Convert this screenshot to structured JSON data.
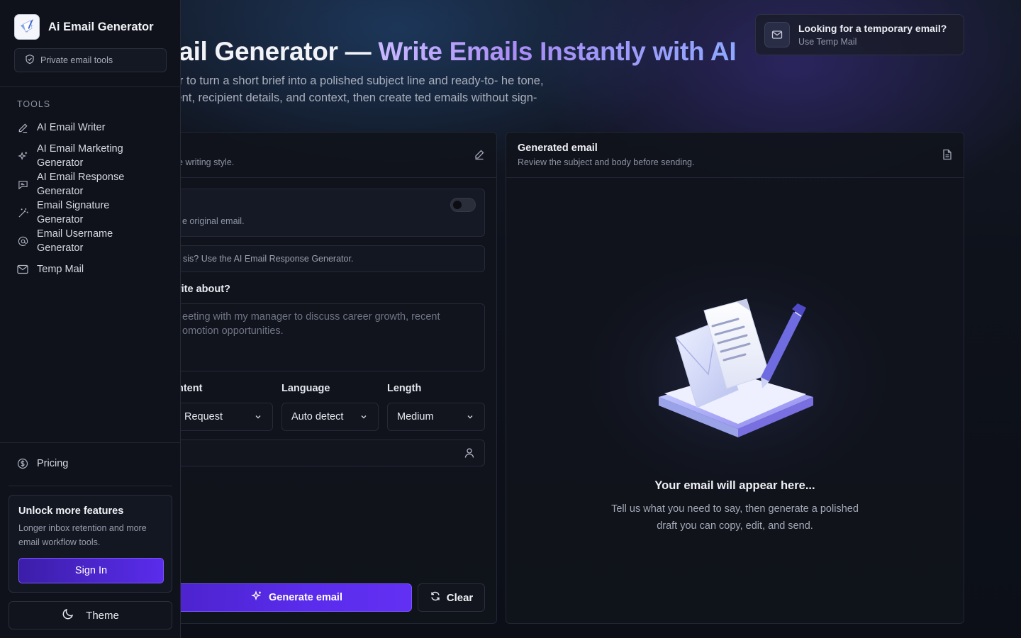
{
  "banner": {
    "title": "Looking for a temporary email?",
    "subtitle": "Use Temp Mail"
  },
  "hero": {
    "title_plain": "nail Generator — ",
    "title_highlight": "Write Emails Instantly with AI",
    "description": "ator to turn a short brief into a polished subject line and ready-to- he tone, intent, recipient details, and context, then create ted emails without sign-up."
  },
  "compose": {
    "subtitle": "ose the writing style.",
    "reply_sub": "e original email.",
    "hint": "sis? Use the AI Email Response Generator.",
    "question": "rite about?",
    "placeholder": "eeting with my manager to discuss career growth, recent omotion opportunities.",
    "intent_label": "ntent",
    "intent_value": "Request",
    "language_label": "Language",
    "language_value": "Auto detect",
    "length_label": "Length",
    "length_value": "Medium",
    "generate_label": "Generate email",
    "clear_label": "Clear"
  },
  "output": {
    "title": "Generated email",
    "subtitle": "Review the subject and body before sending.",
    "empty_title": "Your email will appear here...",
    "empty_desc": "Tell us what you need to say, then generate a polished draft you can copy, edit, and send."
  },
  "sidebar": {
    "brand": "Ai Email Generator",
    "private_label": "Private email tools",
    "tools_heading": "TOOLS",
    "items": [
      {
        "label": "AI Email Writer",
        "icon": "pencil-icon"
      },
      {
        "label": "AI Email Marketing Generator",
        "icon": "sparkles-icon"
      },
      {
        "label": "AI Email Response Generator",
        "icon": "message-reply-icon"
      },
      {
        "label": "Email Signature Generator",
        "icon": "magic-wand-icon"
      },
      {
        "label": "Email Username Generator",
        "icon": "at-sign-icon"
      },
      {
        "label": "Temp Mail",
        "icon": "mail-icon"
      }
    ],
    "pricing_label": "Pricing",
    "unlock_title": "Unlock more features",
    "unlock_desc": "Longer inbox retention and more email workflow tools.",
    "signin_label": "Sign In",
    "theme_label": "Theme"
  },
  "colors": {
    "accent": "#5a2cec",
    "background": "#0d1018",
    "panel": "#10131b"
  }
}
